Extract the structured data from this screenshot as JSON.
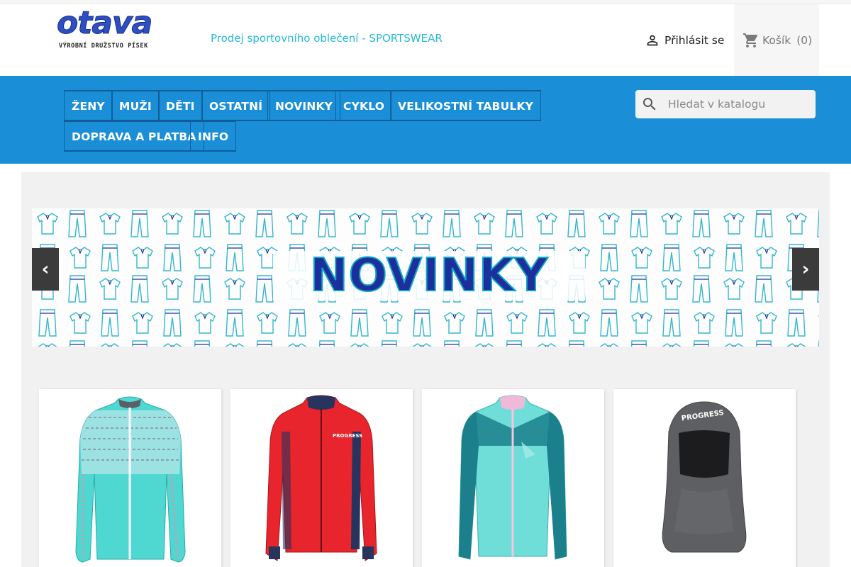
{
  "header": {
    "logo_word": "otava",
    "logo_sub": "VÝROBNÍ DRUŽSTVO PÍSEK",
    "tagline": "Prodej sportovního oblečení - SPORTSWEAR",
    "login_label": "Přihlásit se",
    "cart_label": "Košík",
    "cart_count": "(0)"
  },
  "nav": {
    "items": [
      "ŽENY",
      "MUŽI",
      "DĚTI",
      "OSTATNÍ",
      "NOVINKY",
      "CYKLO",
      "VELIKOSTNÍ TABULKY",
      "DOPRAVA A PLATBA",
      "INFO"
    ]
  },
  "search": {
    "placeholder": "Hledat v katalogu"
  },
  "banner": {
    "title": "NOVINKY",
    "prev_label": "‹",
    "next_label": "›"
  },
  "products": [
    {
      "name": "turquoise-womens-fleece-jacket",
      "logo": ""
    },
    {
      "name": "red-mens-fleece-jacket",
      "logo": ""
    },
    {
      "name": "teal-kids-fleece-jacket",
      "logo": ""
    },
    {
      "name": "gray-balaclava",
      "logo": "PROGRESS"
    }
  ],
  "colors": {
    "accent": "#24b9d7",
    "nav_bg": "#1a8fd8",
    "nav_border": "#0f5e98",
    "banner_title": "#1d2f9c"
  },
  "icons": {
    "login": "person-icon",
    "cart": "shopping-cart-icon",
    "search": "search-icon"
  }
}
